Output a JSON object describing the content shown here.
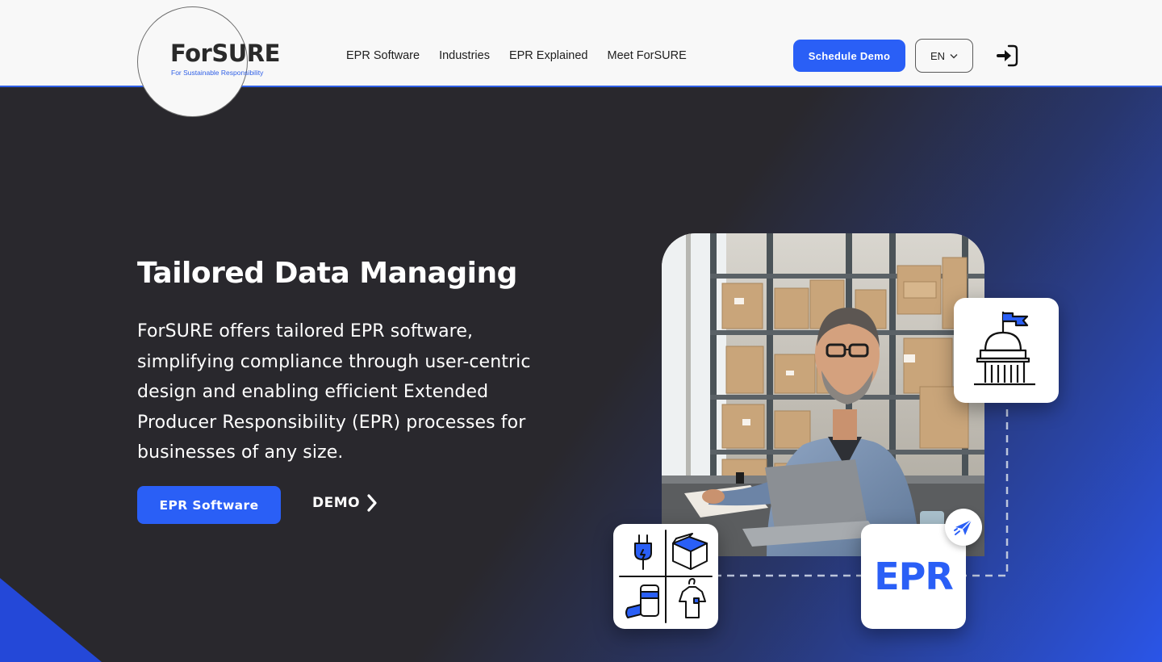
{
  "brand": {
    "name": "ForSURE",
    "tagline": "For Sustainable Responsibility",
    "accent": "#2a5ff6",
    "dark_bg": "#29282d"
  },
  "nav": {
    "items": [
      {
        "label": "EPR Software"
      },
      {
        "label": "Industries"
      },
      {
        "label": "EPR Explained"
      },
      {
        "label": "Meet ForSURE"
      }
    ],
    "schedule_demo_label": "Schedule Demo",
    "language": "EN"
  },
  "hero": {
    "title": "Tailored Data Managing",
    "description": "ForSURE offers tailored EPR software, simplifying compliance through user-centric design and enabling efficient Extended Producer Responsibility (EPR) processes for businesses of any size.",
    "primary_button": "EPR Software",
    "secondary_link": "DEMO"
  },
  "illustration": {
    "epr_card_text": "EPR",
    "icons": [
      "government-building-icon",
      "product-categories-icon",
      "send-icon"
    ]
  }
}
